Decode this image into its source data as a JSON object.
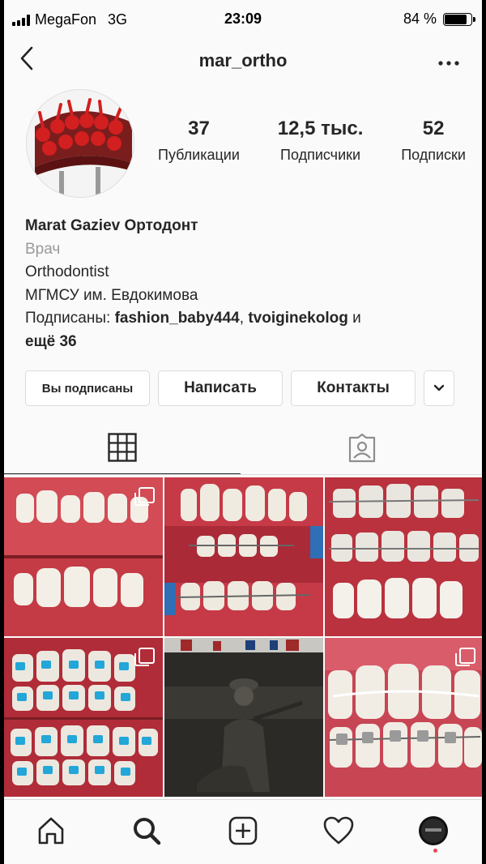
{
  "status_bar": {
    "carrier": "MegaFon",
    "network": "3G",
    "time": "23:09",
    "battery": "84 %",
    "battery_level": 0.84
  },
  "nav": {
    "title": "mar_ortho",
    "back_icon": "chevron-left-icon",
    "more_icon": "more-dots-icon"
  },
  "stats": [
    {
      "value": "37",
      "label": "Публикации"
    },
    {
      "value": "12,5 тыс.",
      "label": "Подписчики"
    },
    {
      "value": "52",
      "label": "Подписки"
    }
  ],
  "bio": {
    "name": "Marat Gaziev Ортодонт",
    "category": "Врач",
    "line1": "Orthodontist",
    "line2": "МГМСУ им. Евдокимова",
    "followed_prefix": "Подписаны: ",
    "followed_user1": "fashion_baby444",
    "followed_sep": ", ",
    "followed_user2": "tvoiginekolog",
    "followed_and": " и",
    "followed_more": "ещё 36"
  },
  "buttons": {
    "following": "Вы подписаны",
    "message": "Написать",
    "contacts": "Контакты"
  },
  "tabs": {
    "grid_icon": "grid-icon",
    "tagged_icon": "tagged-person-icon",
    "active": "grid"
  },
  "colors": {
    "accent": "#262626",
    "muted": "#999999",
    "border": "#dbdbdb",
    "notification": "#ed4956"
  },
  "bottom_nav": [
    "home-icon",
    "search-icon",
    "add-post-icon",
    "heart-icon",
    "profile-avatar"
  ]
}
